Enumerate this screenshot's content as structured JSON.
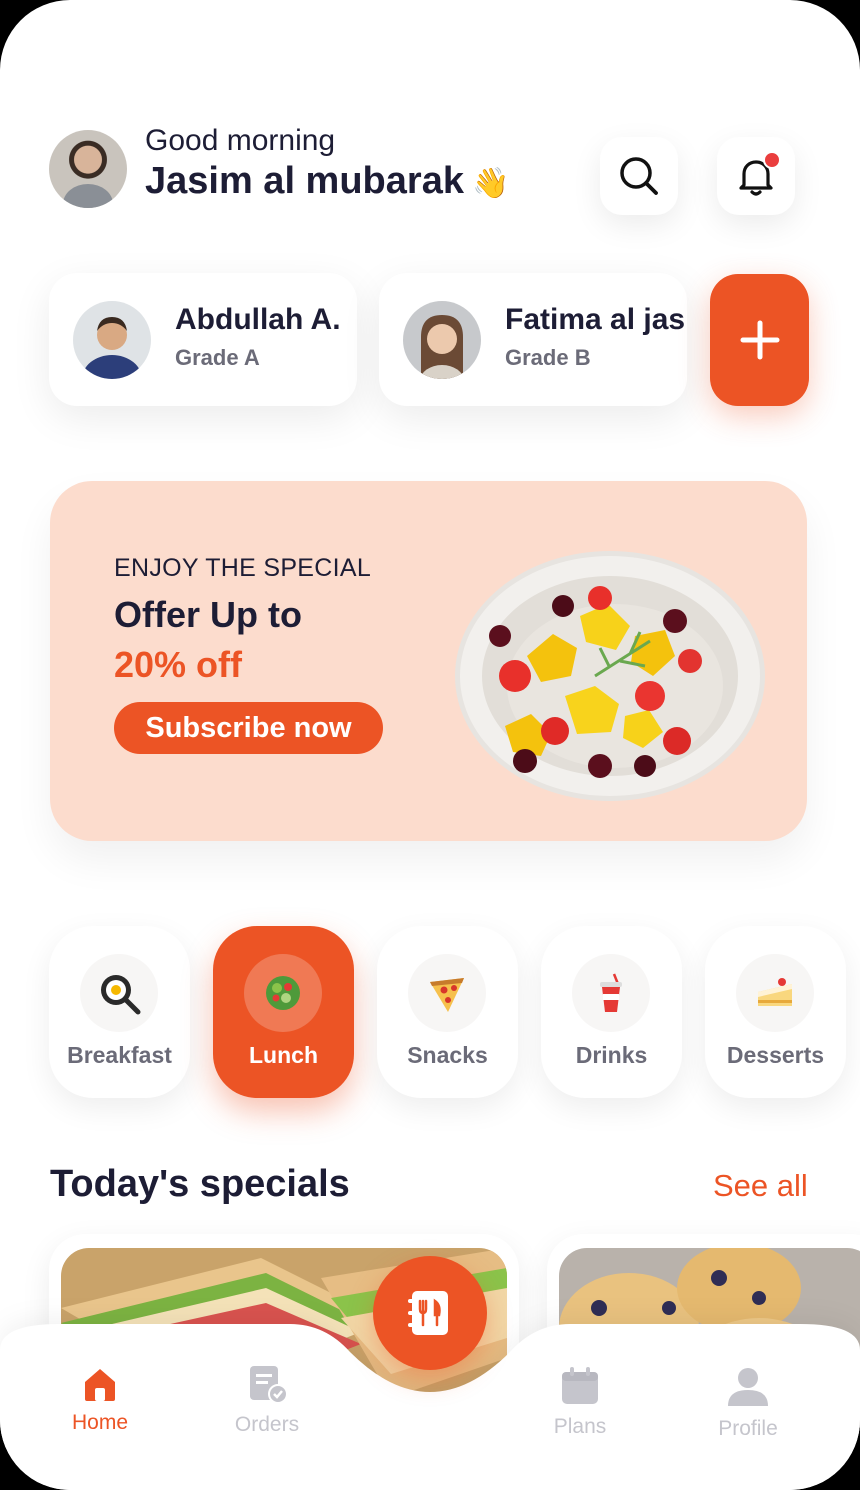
{
  "header": {
    "greeting": "Good morning",
    "user_name": "Jasim al mubarak",
    "wave_emoji": "👋",
    "search_icon": "search-icon",
    "notification_icon": "bell-icon",
    "has_notification": true
  },
  "children": [
    {
      "name": "Abdullah A.",
      "grade": "Grade A"
    },
    {
      "name": "Fatima al jasim",
      "grade": "Grade B"
    }
  ],
  "add_child_icon": "plus-icon",
  "banner": {
    "kicker": "ENJOY THE SPECIAL",
    "title": "Offer Up to",
    "discount": "20% off",
    "cta": "Subscribe now"
  },
  "categories": [
    {
      "label": "Breakfast",
      "icon": "frying-pan-icon",
      "active": false
    },
    {
      "label": "Lunch",
      "icon": "salad-bowl-icon",
      "active": true
    },
    {
      "label": "Snacks",
      "icon": "pizza-slice-icon",
      "active": false
    },
    {
      "label": "Drinks",
      "icon": "drink-cup-icon",
      "active": false
    },
    {
      "label": "Desserts",
      "icon": "cake-slice-icon",
      "active": false
    }
  ],
  "specials": {
    "title": "Today's specials",
    "see_all": "See all"
  },
  "nav": {
    "items": [
      {
        "label": "Home",
        "icon": "home-icon",
        "active": true
      },
      {
        "label": "Orders",
        "icon": "orders-icon",
        "active": false
      },
      {
        "label": "Plans",
        "icon": "calendar-icon",
        "active": false
      },
      {
        "label": "Profile",
        "icon": "profile-icon",
        "active": false
      }
    ],
    "center_icon": "menu-book-icon"
  },
  "colors": {
    "accent": "#ec5425",
    "banner_bg": "#fcdccd",
    "text_dark": "#1d1d35",
    "text_muted": "#6b6b78",
    "nav_inactive": "#c5c5cc"
  }
}
